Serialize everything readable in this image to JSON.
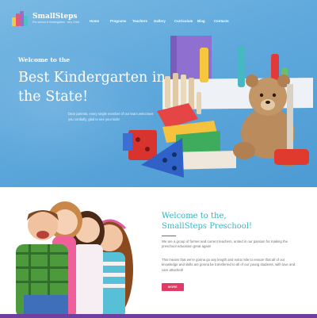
{
  "header": {
    "logo_title": "SmallSteps",
    "logo_subtitle": "Pre-school & Kindergarten · Any Child",
    "nav": [
      "Home",
      "Programs",
      "Teachers",
      "Gallery",
      "Curriculum",
      "Blog",
      "Contacts"
    ]
  },
  "hero": {
    "kicker": "Welcome to the",
    "title": "Best Kindergarten in the State!",
    "text": "Dear parents, every single member of our team welcomes you cordially, glad to see your kids!"
  },
  "welcome": {
    "kicker": "Welcome to the,",
    "title": "SmallSteps Preschool!",
    "paragraph1": "We are a group of former and current teachers, united in our passion for making the preschool education great again!",
    "paragraph2": "This means that we're gonna go any length and extra mile to ensure that all of our knowledge and skills are gonna be transferred to all of our young students, with love and care attached!",
    "button_label": "MORE"
  },
  "colors": {
    "hero_blue": "#5ea8dc",
    "accent_teal": "#37b8c5",
    "accent_pink": "#e23a64",
    "footer_purple": "#6f3fa0"
  }
}
